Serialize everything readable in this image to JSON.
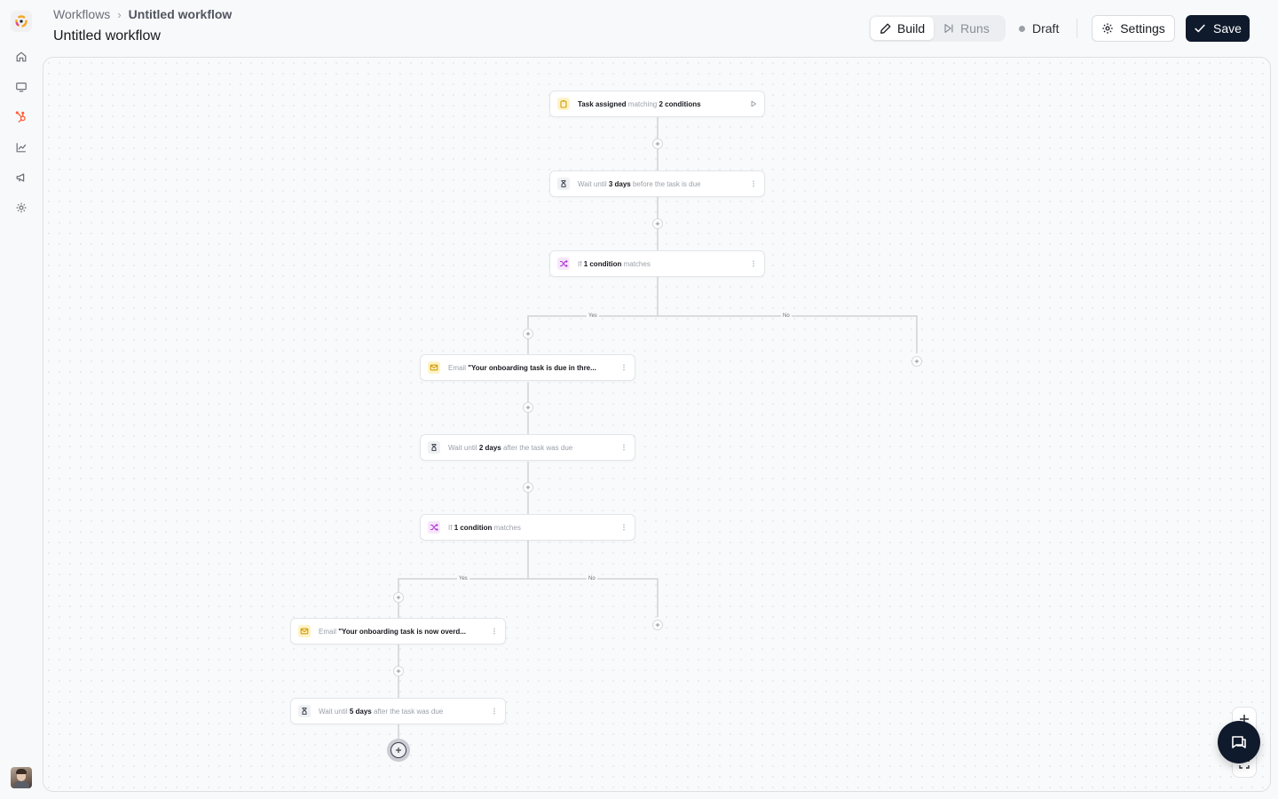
{
  "sidebar": {
    "items": [
      {
        "icon": "home-icon",
        "name": "sidebar-item-home"
      },
      {
        "icon": "monitor-icon",
        "name": "sidebar-item-display"
      },
      {
        "icon": "hubspot-sprocket-icon",
        "name": "sidebar-item-workflows",
        "active_color": "#ff5c35"
      },
      {
        "icon": "chart-icon",
        "name": "sidebar-item-reports"
      },
      {
        "icon": "megaphone-icon",
        "name": "sidebar-item-marketing"
      },
      {
        "icon": "gear-icon",
        "name": "sidebar-item-settings"
      }
    ]
  },
  "header": {
    "breadcrumb": {
      "root": "Workflows",
      "current": "Untitled workflow"
    },
    "title": "Untitled workflow",
    "tabs": [
      {
        "label": "Build",
        "active": true,
        "icon": "pencil-icon"
      },
      {
        "label": "Runs",
        "active": false,
        "icon": "play-skip-icon"
      }
    ],
    "status": "Draft",
    "settings_label": "Settings",
    "save_label": "Save"
  },
  "workflow": {
    "trigger": {
      "text": "Task assigned",
      "mid": "matching",
      "count": "2 conditions",
      "icon": "clipboard-icon"
    },
    "wait1": {
      "pre": "Wait until",
      "bold": "3 days",
      "post": "before the task is due",
      "icon": "hourglass-icon"
    },
    "branch1": {
      "pre": "If",
      "bold": "1 condition",
      "post": "matches",
      "icon": "shuffle-icon",
      "yes_label": "Yes",
      "no_label": "No"
    },
    "email1": {
      "pre": "Email",
      "bold": "\"Your onboarding task is due in thre...",
      "icon": "mail-icon"
    },
    "wait2": {
      "pre": "Wait until",
      "bold": "2 days",
      "post": "after the task was due",
      "icon": "hourglass-icon"
    },
    "branch2": {
      "pre": "If",
      "bold": "1 condition",
      "post": "matches",
      "icon": "shuffle-icon",
      "yes_label": "Yes",
      "no_label": "No"
    },
    "email2": {
      "pre": "Email",
      "bold": "\"Your onboarding task is now overd...",
      "icon": "mail-icon"
    },
    "wait3": {
      "pre": "Wait until",
      "bold": "5 days",
      "post": "after the task was due",
      "icon": "hourglass-icon"
    }
  },
  "colors": {
    "accent": "#0f1a2c",
    "hubspot": "#ff5c35",
    "email": "#d39b07",
    "branch": "#b13bd3"
  }
}
